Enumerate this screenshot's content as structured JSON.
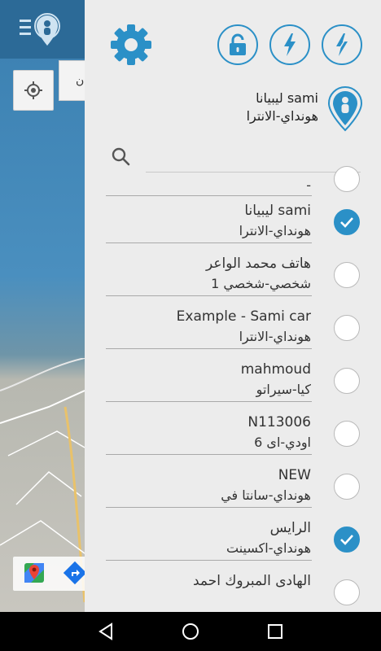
{
  "map": {
    "label_fragment": "ن"
  },
  "current": {
    "name": "ليبيانا sami",
    "sub": "هونداي-الانترا"
  },
  "search": {
    "placeholder": ""
  },
  "vehicles": [
    {
      "name": "",
      "sub": "-",
      "checked": false
    },
    {
      "name": "ليبيانا sami",
      "sub": "هونداي-الانترا",
      "checked": true
    },
    {
      "name": "هاتف محمد الواعر",
      "sub": "شخصي-شخصي 1",
      "checked": false
    },
    {
      "name": "Example - Sami car",
      "sub": "هونداي-الانترا",
      "checked": false
    },
    {
      "name": "mahmoud",
      "sub": "كيا-سيراتو",
      "checked": false
    },
    {
      "name": "N113006",
      "sub": "اودي-اى 6",
      "checked": false
    },
    {
      "name": "NEW",
      "sub": "هونداي-سانتا في",
      "checked": false
    },
    {
      "name": "الرايس",
      "sub": "هونداي-اكسينت",
      "checked": true
    },
    {
      "name": "الهادى المبروك احمد",
      "sub": "",
      "checked": false
    }
  ],
  "colors": {
    "accent": "#2b90c7",
    "drawer_bg": "#ececec",
    "topbar": "#2c6a97"
  },
  "icons": {
    "settings": "gear-icon",
    "lock": "lock-icon",
    "bolt": "lightning-icon",
    "search": "search-icon",
    "pin": "location-pin-icon"
  }
}
